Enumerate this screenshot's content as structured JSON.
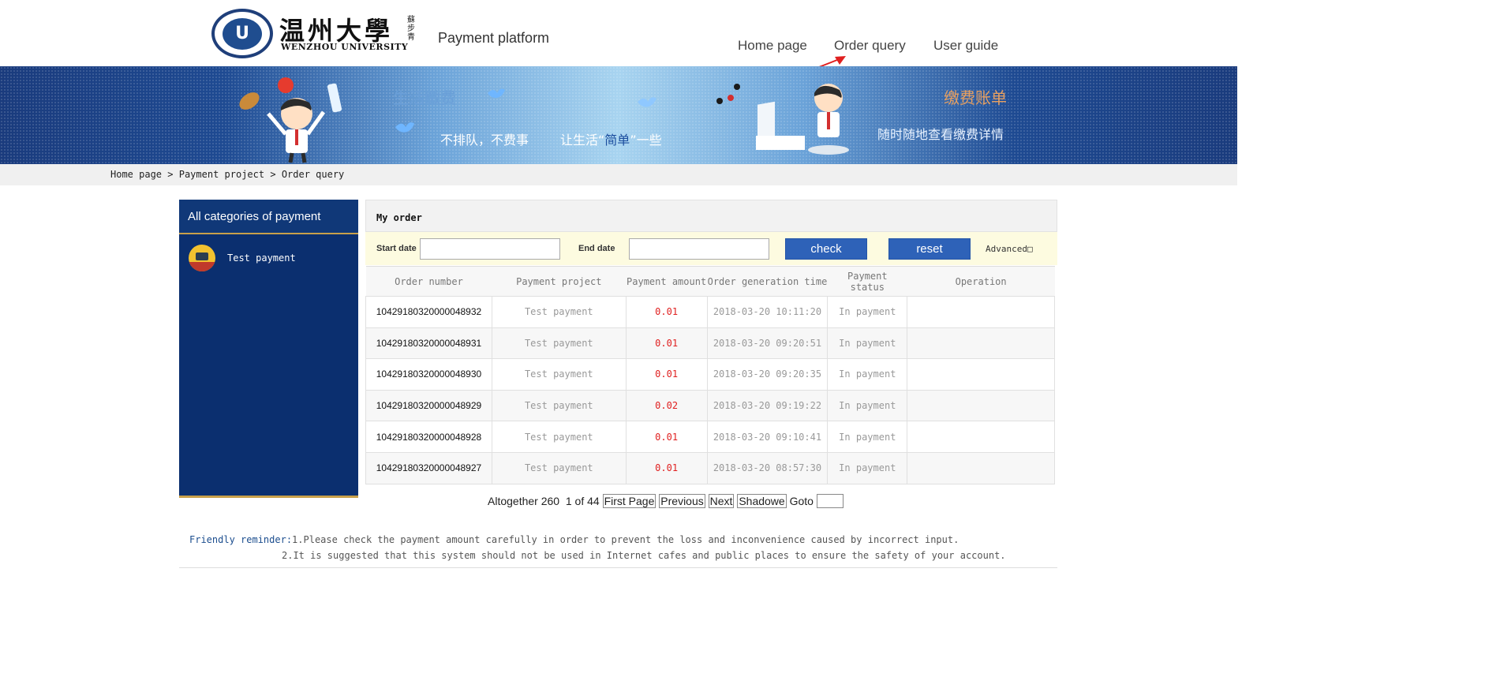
{
  "header": {
    "logo_cn": "温州大學",
    "logo_en": "WENZHOU UNIVERSITY",
    "logo_seal": "蘇步青",
    "logo_emblem": "U",
    "platform": "Payment platform",
    "nav": [
      "Home page",
      "Order query",
      "User guide"
    ]
  },
  "banner": {
    "left_title": "生活缴费",
    "slogan": "不排队，不费事",
    "slogan2_pre": "让生活“",
    "slogan2_hl": "简单",
    "slogan2_post": "”一些",
    "right_title": "缴费账单",
    "right_sub": "随时随地查看缴费详情"
  },
  "breadcrumb": [
    "Home page",
    "Payment project",
    "Order query"
  ],
  "breadcrumb_sep": ">",
  "sidebar": {
    "title": "All categories of payment",
    "items": [
      {
        "label": "Test payment",
        "icon": "computer-icon"
      }
    ]
  },
  "panel": {
    "title": "My order",
    "filter": {
      "start_label": "Start date",
      "start_value": "",
      "end_label": "End date",
      "end_value": "",
      "check_label": "check",
      "reset_label": "reset",
      "advanced_label": "Advanced□"
    },
    "columns": [
      "Order number",
      "Payment project",
      "Payment amount",
      "Order generation time",
      "Payment status",
      "Operation"
    ],
    "rows": [
      [
        "10429180320000048932",
        "Test payment",
        "0.01",
        "2018-03-20 10:11:20",
        "In payment",
        ""
      ],
      [
        "10429180320000048931",
        "Test payment",
        "0.01",
        "2018-03-20 09:20:51",
        "In payment",
        ""
      ],
      [
        "10429180320000048930",
        "Test payment",
        "0.01",
        "2018-03-20 09:20:35",
        "In payment",
        ""
      ],
      [
        "10429180320000048929",
        "Test payment",
        "0.02",
        "2018-03-20 09:19:22",
        "In payment",
        ""
      ],
      [
        "10429180320000048928",
        "Test payment",
        "0.01",
        "2018-03-20 09:10:41",
        "In payment",
        ""
      ],
      [
        "10429180320000048927",
        "Test payment",
        "0.01",
        "2018-03-20 08:57:30",
        "In payment",
        ""
      ]
    ]
  },
  "pager": {
    "total": "Altogether 260",
    "page": "1 of 44",
    "first": "First Page",
    "prev": "Previous",
    "next": "Next",
    "last": "Shadowe",
    "goto": "Goto",
    "goto_value": ""
  },
  "reminder": {
    "label": "Friendly reminder:",
    "line1": "1.Please check the payment amount carefully in order to prevent the loss and inconvenience caused by incorrect input.",
    "line2": "2.It is suggested that this system should not be used in Internet cafes and public places to ensure the safety of your account."
  },
  "colors": {
    "brand_blue": "#0b2f6f",
    "button_blue": "#2e62b8",
    "amount_red": "#e02020",
    "arrow_red": "#e02020"
  }
}
